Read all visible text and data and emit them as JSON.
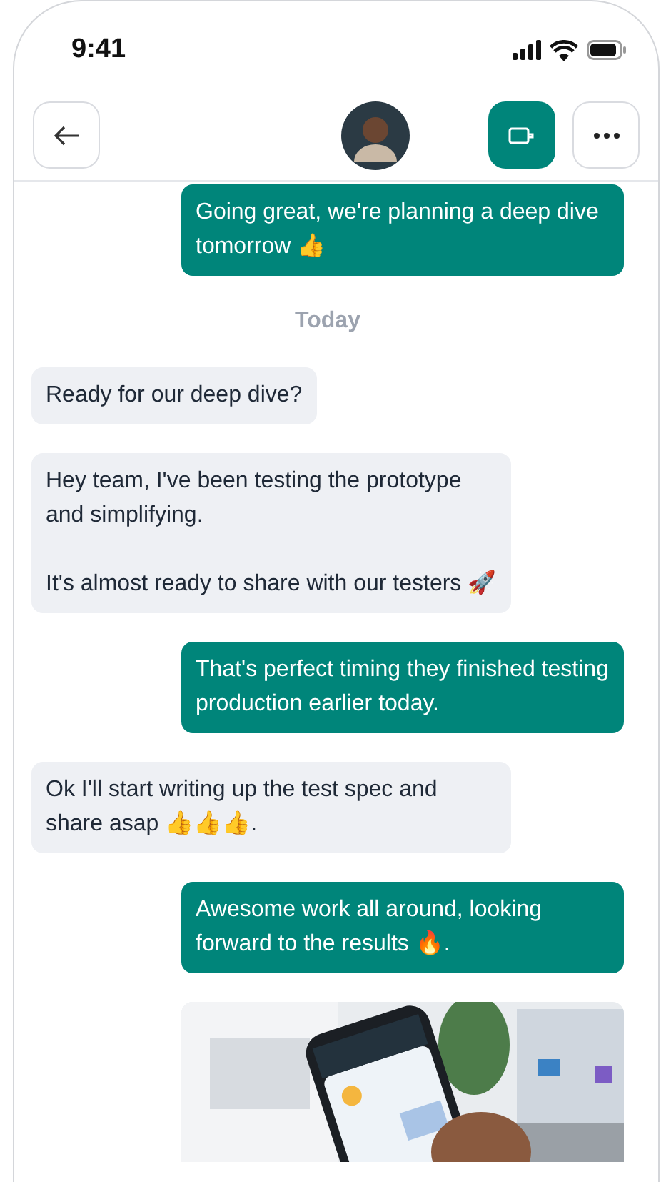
{
  "status_bar": {
    "time": "9:41"
  },
  "header": {
    "video_call_active": true
  },
  "messages": [
    {
      "kind": "outgoing",
      "paragraphs": [
        "Going great, we're planning a deep dive tomorrow 👍"
      ]
    },
    {
      "kind": "divider",
      "text": "Today"
    },
    {
      "kind": "incoming",
      "paragraphs": [
        "Ready for our deep dive?"
      ]
    },
    {
      "kind": "incoming",
      "paragraphs": [
        "Hey team, I've been testing the prototype and simplifying.",
        "It's almost ready to share with our testers 🚀"
      ]
    },
    {
      "kind": "outgoing",
      "paragraphs": [
        "That's perfect timing they finished testing production earlier today."
      ]
    },
    {
      "kind": "incoming",
      "paragraphs": [
        "Ok I'll start writing up the test spec and share asap 👍👍👍."
      ]
    },
    {
      "kind": "outgoing",
      "paragraphs": [
        "Awesome work all around, looking forward to the results 🔥."
      ]
    },
    {
      "kind": "picture"
    }
  ]
}
